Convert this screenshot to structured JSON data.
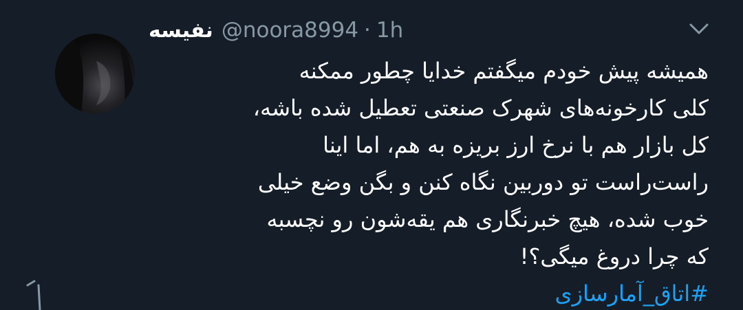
{
  "tweet": {
    "author": {
      "display_name": "نفیسه",
      "handle": "@noora8994"
    },
    "separator": "·",
    "time": "1h",
    "body_lines": [
      "همیشه پیش خودم میگفتم خدایا چطور ممکنه",
      "کلی کارخونه‌های شهرک صنعتی تعطیل شده باشه،",
      "کل بازار هم با نرخ ارز بریزه به هم، اما اینا",
      "راست‌راست تو دوربین نگاه کنن و بگن وضع خیلی",
      "خوب شده، هیچ خبرنگاری هم یقه‌شون رو نچسبه",
      "که چرا دروغ میگی؟!"
    ],
    "hashtag": "#اتاق_آمارسازی",
    "menu_icon": "chevron-down-icon"
  },
  "colors": {
    "background": "#151e28",
    "text": "#ffffff",
    "secondary": "#8899a6",
    "link": "#1da1f2"
  }
}
